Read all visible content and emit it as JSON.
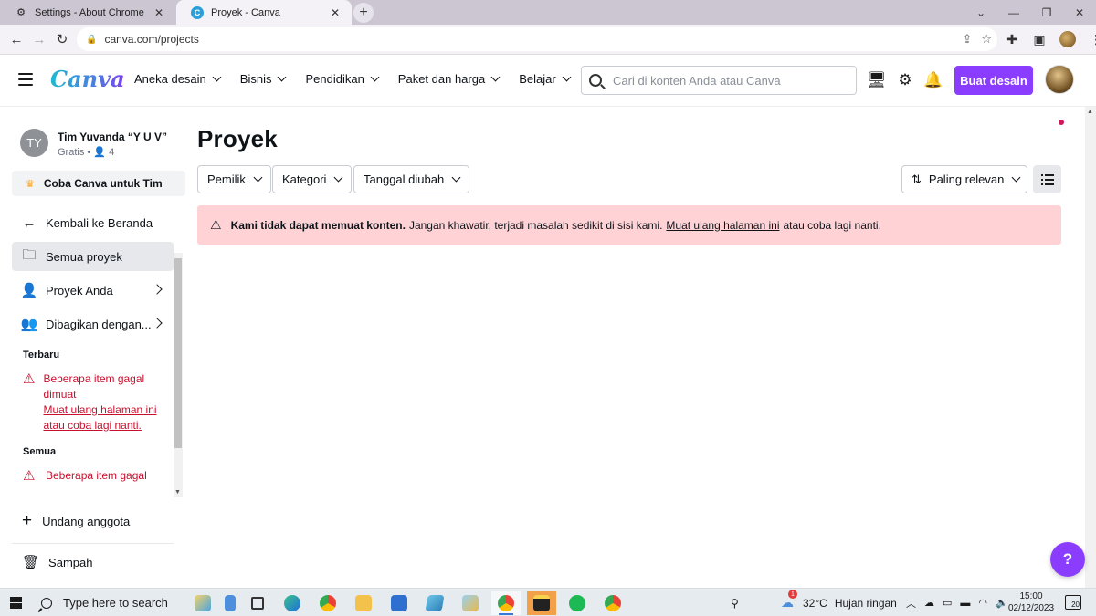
{
  "browser": {
    "tabs": [
      {
        "title": "Settings - About Chrome",
        "icon": "gear-icon",
        "active": false
      },
      {
        "title": "Proyek - Canva",
        "icon": "canva-icon",
        "active": true
      }
    ],
    "url": "canva.com/projects"
  },
  "header": {
    "logo": "Canva",
    "nav": [
      "Aneka desain",
      "Bisnis",
      "Pendidikan",
      "Paket dan harga",
      "Belajar"
    ],
    "search_placeholder": "Cari di konten Anda atau Canva",
    "create_button": "Buat desain"
  },
  "sidebar": {
    "team_initials": "TY",
    "team_name": "Tim Yuvanda “Y U V”",
    "team_plan": "Gratis",
    "team_members": "4",
    "try_team": "Coba Canva untuk Tim",
    "back_home": "Kembali ke Beranda",
    "items": [
      {
        "label": "Semua proyek",
        "icon": "folder-icon",
        "selected": true
      },
      {
        "label": "Proyek Anda",
        "icon": "person-icon"
      },
      {
        "label": "Dibagikan dengan...",
        "icon": "people-icon"
      }
    ],
    "recent_label": "Terbaru",
    "recent_error_title": "Beberapa item gagal dimuat",
    "recent_error_link": "Muat ulang halaman ini",
    "recent_error_tail": "atau coba lagi nanti.",
    "all_label": "Semua",
    "all_error_title": "Beberapa item gagal",
    "invite": "Undang anggota",
    "trash": "Sampah"
  },
  "main": {
    "title": "Proyek",
    "filters": [
      "Pemilik",
      "Kategori",
      "Tanggal diubah"
    ],
    "sort": "Paling relevan",
    "alert_bold": "Kami tidak dapat memuat konten.",
    "alert_text": "Jangan khawatir, terjadi masalah sedikit di sisi kami.",
    "alert_link": "Muat ulang halaman ini",
    "alert_tail": "atau coba lagi nanti."
  },
  "help_label": "?",
  "taskbar": {
    "search_placeholder": "Type here to search",
    "weather_temp": "32°C",
    "weather_desc": "Hujan ringan",
    "weather_badge": "1",
    "time": "15:00",
    "date": "02/12/2023",
    "notifications": "20"
  },
  "colors": {
    "accent": "#8b3dff",
    "error": "#c8102e",
    "alert_bg": "#ffd3d6"
  }
}
